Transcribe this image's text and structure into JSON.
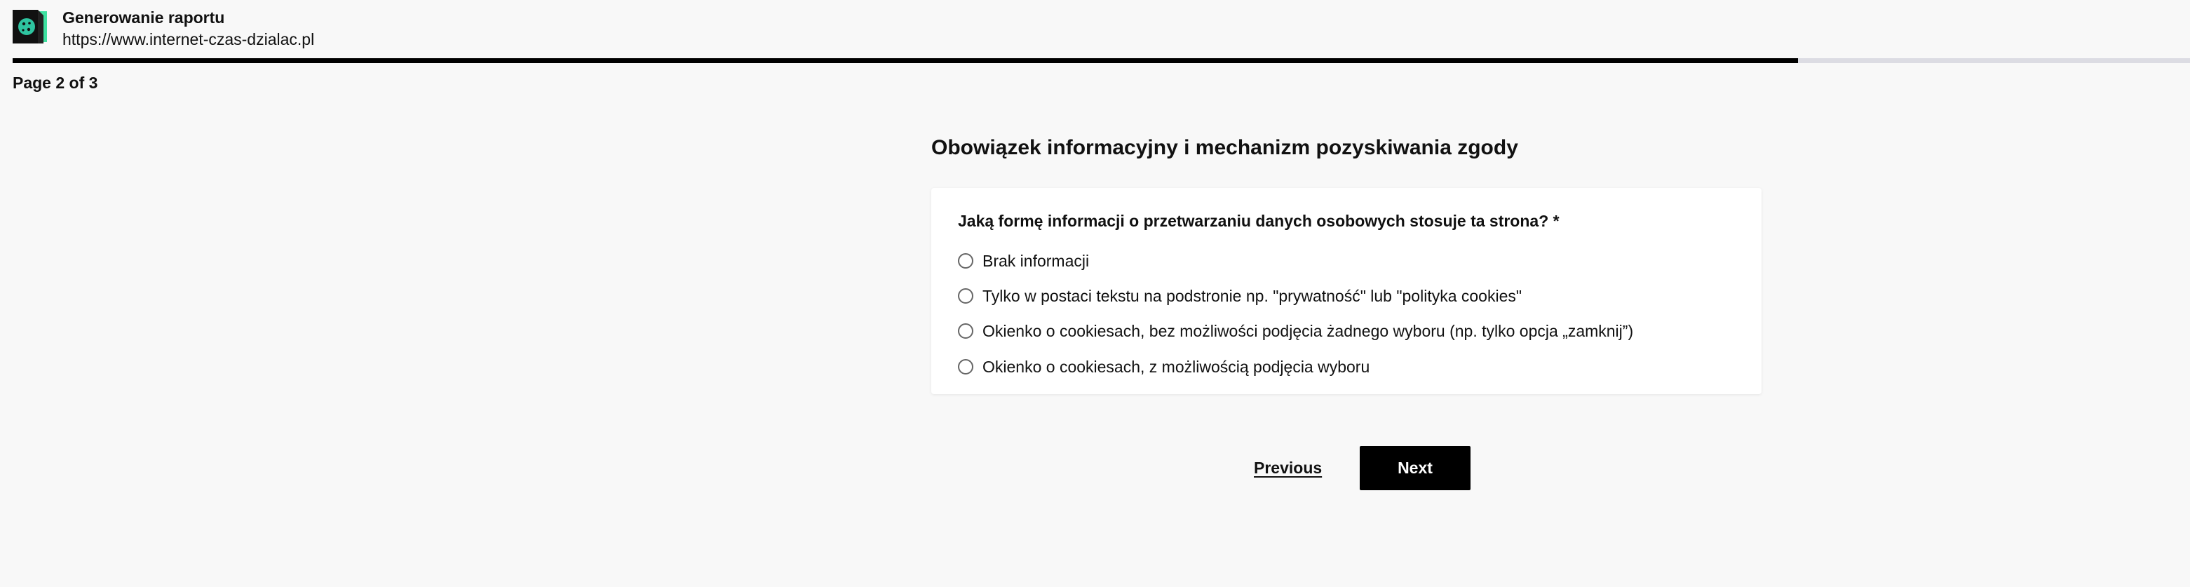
{
  "header": {
    "title": "Generowanie raportu",
    "url": "https://www.internet-czas-dzialac.pl",
    "logo_icon": "cookie-scanner-logo-icon"
  },
  "progress": {
    "fraction": 0.82
  },
  "pagination": {
    "indicator": "Page 2 of 3"
  },
  "section": {
    "title": "Obowiązek informacyjny i mechanizm pozyskiwania zgody"
  },
  "form": {
    "question": "Jaką formę informacji o przetwarzaniu danych osobowych stosuje ta strona? *",
    "options": [
      {
        "label": "Brak informacji",
        "selected": false
      },
      {
        "label": "Tylko w postaci tekstu na podstronie np. \"prywatność\" lub \"polityka cookies\"",
        "selected": false
      },
      {
        "label": "Okienko o cookiesach, bez możliwości podjęcia żadnego wyboru (np. tylko opcja „zamknij”)",
        "selected": false
      },
      {
        "label": "Okienko o cookiesach, z możliwością podjęcia wyboru",
        "selected": false
      }
    ]
  },
  "nav": {
    "previous_label": "Previous",
    "next_label": "Next"
  },
  "colors": {
    "accent": "#000000",
    "progress_track": "#dcdce3",
    "logo_accent": "#3ee0a0",
    "background": "#f8f8f8"
  }
}
